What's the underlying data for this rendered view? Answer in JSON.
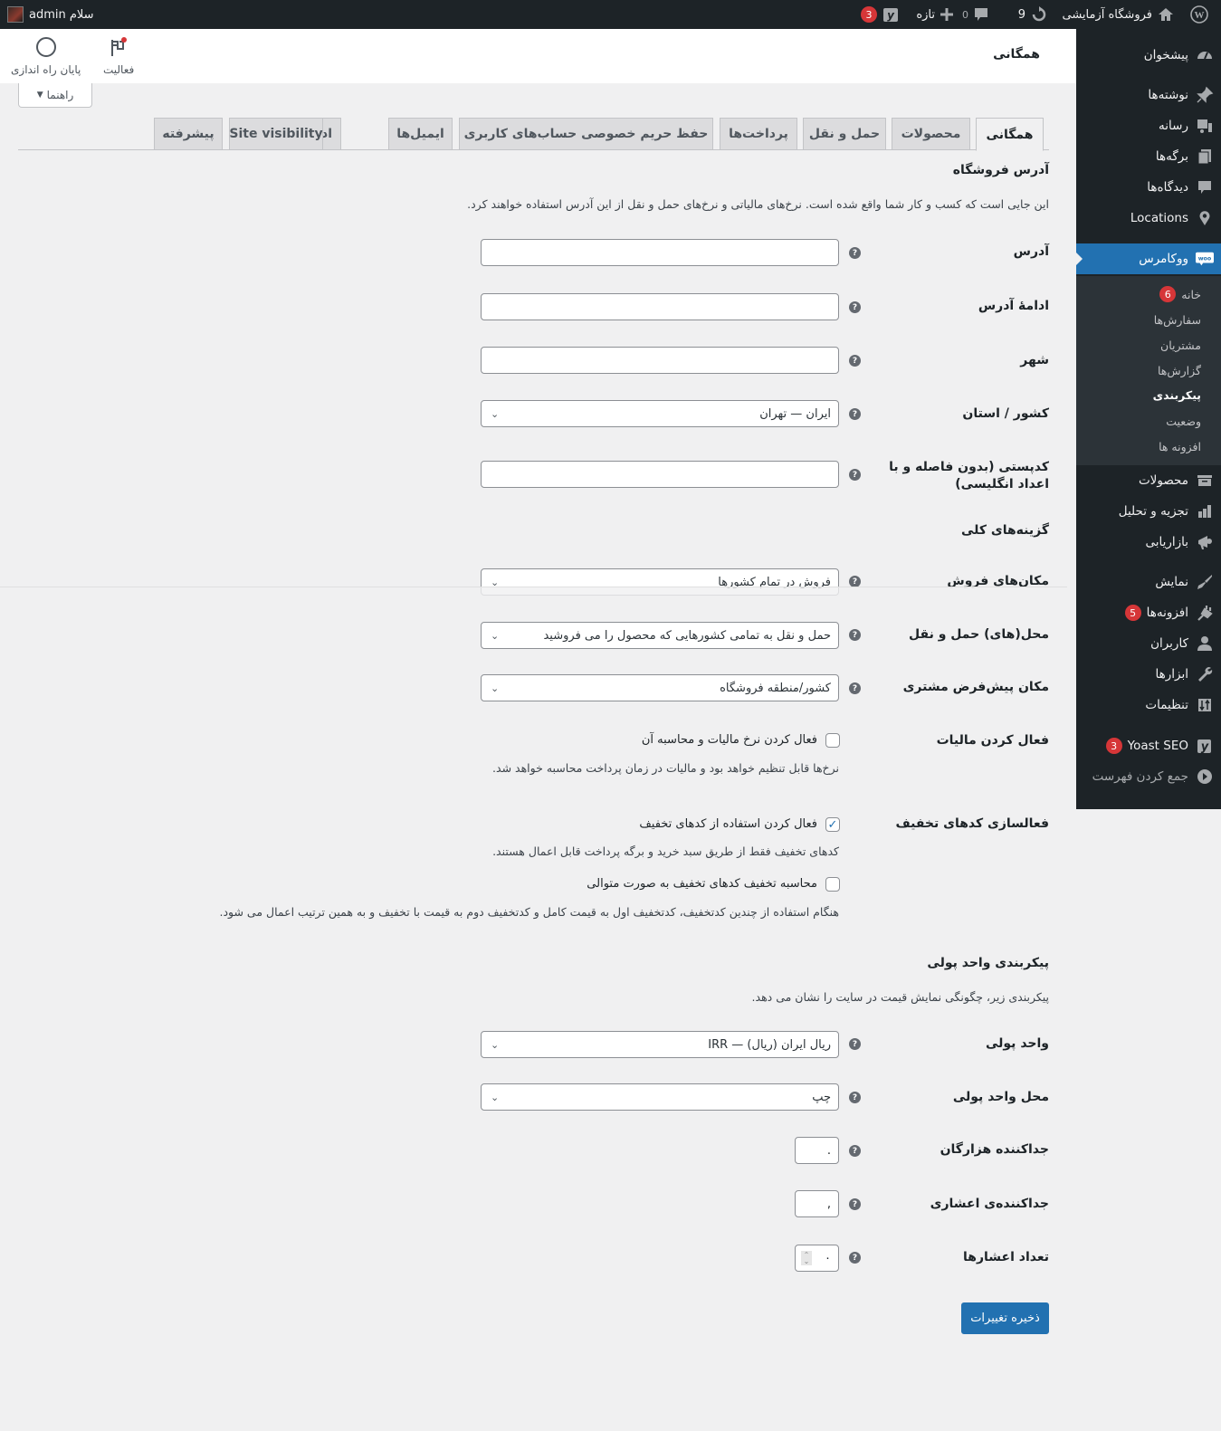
{
  "adminbar": {
    "site_name": "فروشگاه آزمایشی",
    "updates_count": "9",
    "comments_count": "0",
    "new_label": "تازه",
    "yoast_badge": "3",
    "greeting": "سلام admin"
  },
  "sidebar": {
    "items": [
      {
        "label": "پیشخوان",
        "icon": "dashboard-icon"
      },
      {
        "label": "نوشته‌ها",
        "icon": "pin-icon"
      },
      {
        "label": "رسانه",
        "icon": "media-icon"
      },
      {
        "label": "برگه‌ها",
        "icon": "pages-icon"
      },
      {
        "label": "دیدگاه‌ها",
        "icon": "comment-icon"
      },
      {
        "label": "Locations",
        "icon": "location-icon"
      },
      {
        "label": "ووکامرس",
        "icon": "woo-icon",
        "active": true
      },
      {
        "label": "محصولات",
        "icon": "archive-icon"
      },
      {
        "label": "تجزیه و تحلیل",
        "icon": "chart-bar-icon"
      },
      {
        "label": "بازاریابی",
        "icon": "megaphone-icon"
      },
      {
        "label": "نمایش",
        "icon": "brush-icon"
      },
      {
        "label": "افزونه‌ها",
        "icon": "plugin-icon",
        "badge": "5"
      },
      {
        "label": "کاربران",
        "icon": "user-icon"
      },
      {
        "label": "ابزارها",
        "icon": "wrench-icon"
      },
      {
        "label": "تنظیمات",
        "icon": "settings-icon"
      },
      {
        "label": "Yoast SEO",
        "icon": "yoast-icon",
        "badge": "3"
      },
      {
        "label": "جمع کردن فهرست",
        "icon": "collapse-icon"
      }
    ],
    "woo_submenu": [
      {
        "label": "خانه",
        "badge": "6"
      },
      {
        "label": "سفارش‌ها"
      },
      {
        "label": "مشتریان"
      },
      {
        "label": "گزارش‌ها"
      },
      {
        "label": "پیکربندی",
        "current": true
      },
      {
        "label": "وضعیت"
      },
      {
        "label": "افزونه ها"
      }
    ]
  },
  "header": {
    "title": "همگانی",
    "activity_label": "فعالیت",
    "finish_setup_label": "پایان راه اندازی",
    "help_label": "راهنما"
  },
  "tabs": [
    "همگانی",
    "محصولات",
    "حمل و نقل",
    "پرداخت‌ها",
    "حفظ حریم خصوصی حساب‌های کاربری",
    "ایمیل‌ها",
    "ادغام",
    "Site visibility",
    "پیشرفته"
  ],
  "store_address": {
    "heading": "آدرس فروشگاه",
    "description": "این جایی است که کسب و کار شما واقع شده است. نرخ‌های مالیاتی و نرخ‌های حمل و نقل از این آدرس استفاده خواهند کرد.",
    "address_label": "آدرس",
    "address_value": "",
    "address2_label": "ادامهٔ آدرس",
    "address2_value": "",
    "city_label": "شهر",
    "city_value": "",
    "country_label": "کشور / استان",
    "country_value": "ایران — تهران",
    "postcode_label": "کدپستی (بدون فاصله و با اعداد انگلیسی)",
    "postcode_value": ""
  },
  "general_options": {
    "heading": "گزینه‌های کلی",
    "selling_label": "مکان‌های فروش",
    "selling_value": "فروش در تمام کشورها",
    "shipping_label": "محل(های) حمل و نقل",
    "shipping_value": "حمل و نقل به تمامی کشورهایی که محصول را می فروشید",
    "default_location_label": "مکان پیش‌فرض مشتری",
    "default_location_value": "کشور/منطقه فروشگاه",
    "taxes_label": "فعال کردن مالیات",
    "taxes_checkbox_label": "فعال کردن نرخ مالیات و محاسبه آن",
    "taxes_checked": false,
    "taxes_desc": "نرخ‌ها قابل تنظیم خواهد بود و مالیات در زمان پرداخت محاسبه خواهد شد.",
    "coupons_label": "فعالسازی کدهای تخفیف",
    "coupons_checkbox_label": "فعال کردن استفاده از کدهای تخفیف",
    "coupons_checked": true,
    "coupons_desc": "کدهای تخفیف فقط از طریق سبد خرید و برگه پرداخت قابل اعمال هستند.",
    "sequential_checkbox_label": "محاسبه تخفیف کدهای تخفیف به صورت متوالی",
    "sequential_checked": false,
    "sequential_desc": "هنگام استفاده از چندین کدتخفیف، کدتخفیف اول به قیمت کامل و کدتخفیف دوم به قیمت با تخفیف و به همین ترتیب اعمال می شود."
  },
  "currency": {
    "heading": "پیکربندی واحد پولی",
    "description": "پیکربندی زیر، چگونگی نمایش قیمت در سایت را نشان می دهد.",
    "currency_label": "واحد پولی",
    "currency_value": "ریال ایران (ریال) — IRR",
    "position_label": "محل واحد پولی",
    "position_value": "چپ",
    "thousand_sep_label": "جداکننده هزارگان",
    "thousand_sep_value": ".",
    "decimal_sep_label": "جداکننده‌ی اعشاری",
    "decimal_sep_value": ",",
    "decimals_label": "تعداد اعشارها",
    "decimals_value": "۰"
  },
  "save_label": "ذخیره تغییرات",
  "help_glyph": "?",
  "chevron_glyph": "⌄",
  "check_glyph": "✓"
}
